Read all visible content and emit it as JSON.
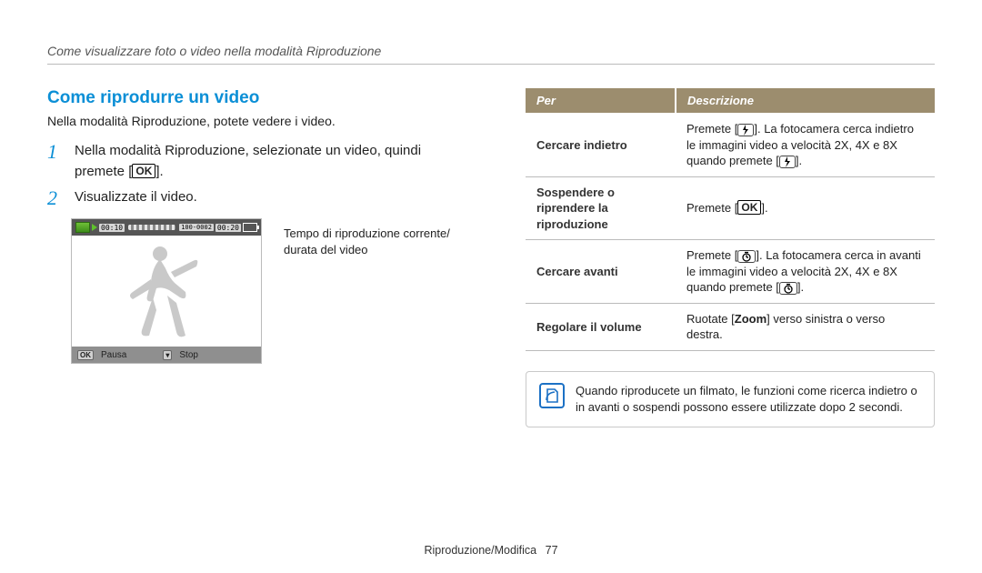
{
  "breadcrumb": "Come visualizzare foto o video nella modalità Riproduzione",
  "section_title": "Come riprodurre un video",
  "intro": "Nella modalità Riproduzione, potete vedere i video.",
  "steps": [
    {
      "num": "1",
      "text_before": "Nella modalità Riproduzione, selezionate un video, quindi premete [",
      "text_after": "]."
    },
    {
      "num": "2",
      "text_before": "Visualizzate il video.",
      "text_after": ""
    }
  ],
  "ok_label": "OK",
  "camera": {
    "time_current": "00:10",
    "time_total": "00:20",
    "counter": "100-0002",
    "bottom_pause": "Pausa",
    "bottom_stop": "Stop",
    "bottom_key_ok": "OK"
  },
  "callout_line1": "Tempo di riproduzione corrente/",
  "callout_line2": "durata del video",
  "table": {
    "header_per": "Per",
    "header_desc": "Descrizione",
    "rows": [
      {
        "label": "Cercare indietro",
        "desc_before": "Premete [",
        "icon": "flash",
        "desc_mid": "]. La fotocamera cerca indietro le immagini video a velocità 2X, 4X e 8X quando premete [",
        "desc_after": "]."
      },
      {
        "label_l1": "Sospendere o",
        "label_l2": "riprendere la",
        "label_l3": "riproduzione",
        "desc_before": "Premete [",
        "icon": "ok",
        "desc_after": "]."
      },
      {
        "label": "Cercare avanti",
        "desc_before": "Premete [",
        "icon": "timer",
        "desc_mid": "]. La fotocamera cerca in avanti le immagini video a velocità 2X, 4X e 8X quando premete [",
        "desc_after": "]."
      },
      {
        "label": "Regolare il volume",
        "desc_before": "Ruotate [",
        "zoom_label": "Zoom",
        "desc_after": "] verso sinistra o verso destra."
      }
    ]
  },
  "note": "Quando riproducete un filmato, le funzioni come ricerca indietro o in avanti o sospendi possono essere utilizzate dopo 2 secondi.",
  "footer_section": "Riproduzione/Modifica",
  "footer_page": "77"
}
